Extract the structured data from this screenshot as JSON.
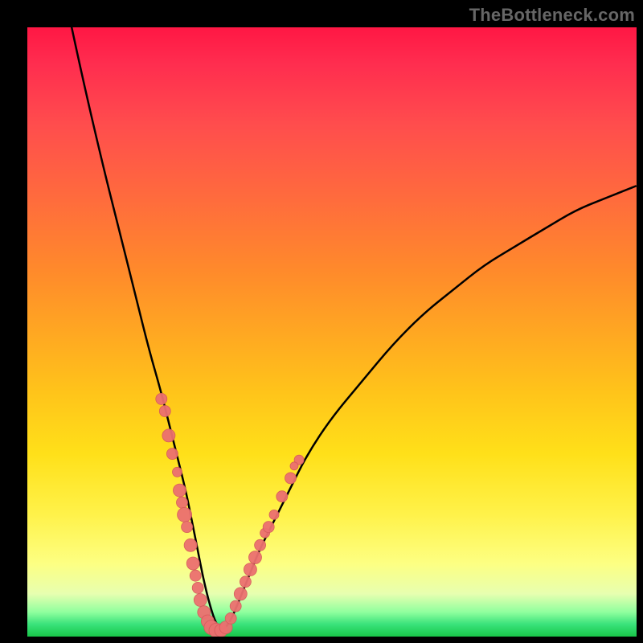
{
  "watermark": "TheBottleneck.com",
  "colors": {
    "frame": "#000000",
    "curve": "#000000",
    "dot_fill": "#ec7070",
    "dot_stroke": "#d45a5a",
    "gradient": [
      "#ff1744",
      "#ff4d4d",
      "#ff8a2b",
      "#ffc41a",
      "#fff24a",
      "#fdff82",
      "#8fff9e",
      "#18c649"
    ]
  },
  "chart_data": {
    "type": "line",
    "title": "",
    "subtitle": "",
    "xlabel": "",
    "ylabel": "",
    "xlim": [
      0,
      100
    ],
    "ylim": [
      0,
      100
    ],
    "legend": false,
    "grid": false,
    "axes_visible": false,
    "series": [
      {
        "name": "bottleneck-curve",
        "style": "line",
        "x": [
          0,
          3,
          6,
          9,
          12,
          15,
          18,
          20,
          22,
          24,
          26,
          27,
          28,
          29,
          30,
          31,
          32,
          33,
          34,
          36,
          38,
          40,
          43,
          46,
          50,
          55,
          60,
          65,
          70,
          75,
          80,
          85,
          90,
          95,
          100
        ],
        "y": [
          135,
          120,
          106,
          92,
          79,
          67,
          55,
          47,
          40,
          32,
          24,
          19,
          14,
          9,
          5,
          2,
          1,
          2,
          4,
          9,
          14,
          18,
          24,
          30,
          36,
          42,
          48,
          53,
          57,
          61,
          64,
          67,
          70,
          72,
          74
        ]
      },
      {
        "name": "sample-dots",
        "style": "scatter",
        "points": [
          {
            "x": 22.0,
            "y": 39,
            "r": 7
          },
          {
            "x": 22.6,
            "y": 37,
            "r": 7
          },
          {
            "x": 23.2,
            "y": 33,
            "r": 8
          },
          {
            "x": 23.8,
            "y": 30,
            "r": 7
          },
          {
            "x": 24.6,
            "y": 27,
            "r": 6
          },
          {
            "x": 25.0,
            "y": 24,
            "r": 8
          },
          {
            "x": 25.4,
            "y": 22,
            "r": 7
          },
          {
            "x": 25.8,
            "y": 20,
            "r": 9
          },
          {
            "x": 26.2,
            "y": 18,
            "r": 7
          },
          {
            "x": 26.8,
            "y": 15,
            "r": 8
          },
          {
            "x": 27.2,
            "y": 12,
            "r": 8
          },
          {
            "x": 27.6,
            "y": 10,
            "r": 7
          },
          {
            "x": 28.0,
            "y": 8,
            "r": 7
          },
          {
            "x": 28.4,
            "y": 6,
            "r": 8
          },
          {
            "x": 29.0,
            "y": 4,
            "r": 8
          },
          {
            "x": 29.6,
            "y": 2.5,
            "r": 8
          },
          {
            "x": 30.2,
            "y": 1.5,
            "r": 9
          },
          {
            "x": 31.0,
            "y": 1.0,
            "r": 9
          },
          {
            "x": 31.8,
            "y": 1.0,
            "r": 8
          },
          {
            "x": 32.6,
            "y": 1.5,
            "r": 8
          },
          {
            "x": 33.4,
            "y": 3,
            "r": 7
          },
          {
            "x": 34.2,
            "y": 5,
            "r": 7
          },
          {
            "x": 35.0,
            "y": 7,
            "r": 8
          },
          {
            "x": 35.8,
            "y": 9,
            "r": 7
          },
          {
            "x": 36.6,
            "y": 11,
            "r": 8
          },
          {
            "x": 37.4,
            "y": 13,
            "r": 8
          },
          {
            "x": 38.2,
            "y": 15,
            "r": 7
          },
          {
            "x": 39.0,
            "y": 17,
            "r": 6
          },
          {
            "x": 39.6,
            "y": 18,
            "r": 7
          },
          {
            "x": 40.5,
            "y": 20,
            "r": 6
          },
          {
            "x": 41.8,
            "y": 23,
            "r": 7
          },
          {
            "x": 43.2,
            "y": 26,
            "r": 7
          },
          {
            "x": 44.6,
            "y": 29,
            "r": 6
          },
          {
            "x": 43.8,
            "y": 28,
            "r": 5
          }
        ]
      }
    ],
    "notes": "V-shaped bottleneck curve on red→green vertical gradient; minimum near x≈31. Axis ticks and labels are not shown in the source image; x domain assumed 0–100 and y domain 0–100 for mapping. Dots are salmon semi-transparent markers clustered along the curve near the trough."
  }
}
